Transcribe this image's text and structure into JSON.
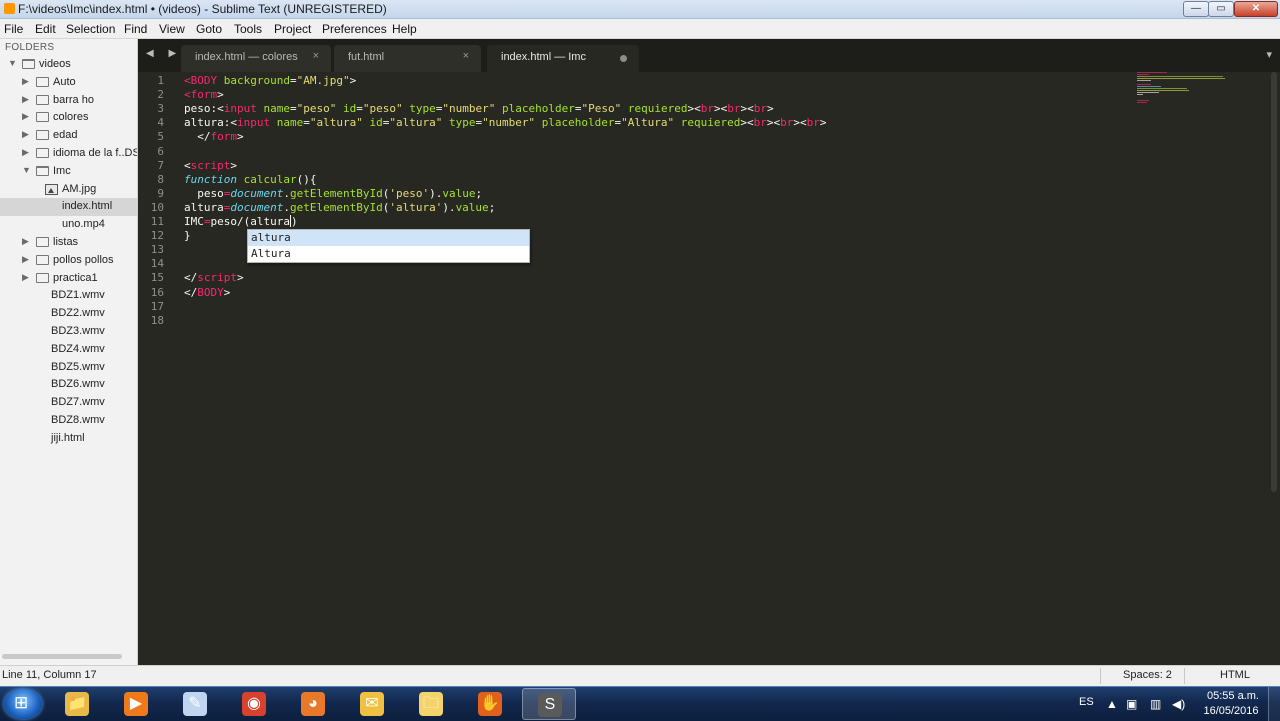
{
  "window": {
    "title": "F:\\videos\\Imc\\index.html • (videos) - Sublime Text (UNREGISTERED)",
    "min_glyph": "—",
    "max_glyph": "▭",
    "close_glyph": "✕"
  },
  "menu": [
    "File",
    "Edit",
    "Selection",
    "Find",
    "View",
    "Goto",
    "Tools",
    "Project",
    "Preferences",
    "Help"
  ],
  "sidebar": {
    "header": "FOLDERS",
    "items": [
      {
        "label": "videos",
        "type": "folder-open",
        "level": 0
      },
      {
        "label": "Auto",
        "type": "folder",
        "level": 1
      },
      {
        "label": "barra ho",
        "type": "folder",
        "level": 1
      },
      {
        "label": "colores",
        "type": "folder",
        "level": 1
      },
      {
        "label": "edad",
        "type": "folder",
        "level": 1
      },
      {
        "label": "idioma de la f..DS",
        "type": "folder",
        "level": 1
      },
      {
        "label": "Imc",
        "type": "folder-open",
        "level": 1
      },
      {
        "label": "AM.jpg",
        "type": "image",
        "level": 2
      },
      {
        "label": "index.html",
        "type": "file",
        "level": 2,
        "selected": true
      },
      {
        "label": "uno.mp4",
        "type": "file",
        "level": 2
      },
      {
        "label": "listas",
        "type": "folder",
        "level": 1
      },
      {
        "label": "pollos pollos",
        "type": "folder",
        "level": 1
      },
      {
        "label": "practica1",
        "type": "folder",
        "level": 1
      },
      {
        "label": "BDZ1.wmv",
        "type": "file",
        "level": 1
      },
      {
        "label": "BDZ2.wmv",
        "type": "file",
        "level": 1
      },
      {
        "label": "BDZ3.wmv",
        "type": "file",
        "level": 1
      },
      {
        "label": "BDZ4.wmv",
        "type": "file",
        "level": 1
      },
      {
        "label": "BDZ5.wmv",
        "type": "file",
        "level": 1
      },
      {
        "label": "BDZ6.wmv",
        "type": "file",
        "level": 1
      },
      {
        "label": "BDZ7.wmv",
        "type": "file",
        "level": 1
      },
      {
        "label": "BDZ8.wmv",
        "type": "file",
        "level": 1
      },
      {
        "label": "jiji.html",
        "type": "file",
        "level": 1
      }
    ]
  },
  "tabs": [
    {
      "label": "index.html — colores",
      "active": false,
      "close": "×"
    },
    {
      "label": "fut.html",
      "active": false,
      "close": "×"
    },
    {
      "label": "index.html — Imc",
      "active": true,
      "dirty": true
    }
  ],
  "tabbar": {
    "nav": "◀ ▶",
    "menu": "▾"
  },
  "editor": {
    "lines": [
      [
        [
          "tag",
          "<"
        ],
        [
          "tag",
          "BODY"
        ],
        [
          "plain",
          " "
        ],
        [
          "attr",
          "background"
        ],
        [
          "plain",
          "="
        ],
        [
          "str",
          "\"AM.jpg\""
        ],
        [
          "plain",
          ">"
        ]
      ],
      [
        [
          "tag",
          "<"
        ],
        [
          "tag",
          "form"
        ],
        [
          "plain",
          ">"
        ]
      ],
      [
        [
          "plain",
          "peso:<"
        ],
        [
          "tag",
          "input"
        ],
        [
          "plain",
          " "
        ],
        [
          "attr",
          "name"
        ],
        [
          "plain",
          "="
        ],
        [
          "str",
          "\"peso\""
        ],
        [
          "plain",
          " "
        ],
        [
          "attr",
          "id"
        ],
        [
          "plain",
          "="
        ],
        [
          "str",
          "\"peso\""
        ],
        [
          "plain",
          " "
        ],
        [
          "attr",
          "type"
        ],
        [
          "plain",
          "="
        ],
        [
          "str",
          "\"number\""
        ],
        [
          "plain",
          " "
        ],
        [
          "attr",
          "placeholder"
        ],
        [
          "plain",
          "="
        ],
        [
          "str",
          "\"Peso\""
        ],
        [
          "plain",
          " "
        ],
        [
          "attr",
          "requiered"
        ],
        [
          "plain",
          ">"
        ],
        [
          "plain",
          "<"
        ],
        [
          "tag",
          "br"
        ],
        [
          "plain",
          "><"
        ],
        [
          "tag",
          "br"
        ],
        [
          "plain",
          "><"
        ],
        [
          "tag",
          "br"
        ],
        [
          "plain",
          ">"
        ]
      ],
      [
        [
          "plain",
          "altura:<"
        ],
        [
          "tag",
          "input"
        ],
        [
          "plain",
          " "
        ],
        [
          "attr",
          "name"
        ],
        [
          "plain",
          "="
        ],
        [
          "str",
          "\"altura\""
        ],
        [
          "plain",
          " "
        ],
        [
          "attr",
          "id"
        ],
        [
          "plain",
          "="
        ],
        [
          "str",
          "\"altura\""
        ],
        [
          "plain",
          " "
        ],
        [
          "attr",
          "type"
        ],
        [
          "plain",
          "="
        ],
        [
          "str",
          "\"number\""
        ],
        [
          "plain",
          " "
        ],
        [
          "attr",
          "placeholder"
        ],
        [
          "plain",
          "="
        ],
        [
          "str",
          "\"Altura\""
        ],
        [
          "plain",
          " "
        ],
        [
          "attr",
          "requiered"
        ],
        [
          "plain",
          ">"
        ],
        [
          "plain",
          "<"
        ],
        [
          "tag",
          "br"
        ],
        [
          "plain",
          "><"
        ],
        [
          "tag",
          "br"
        ],
        [
          "plain",
          "><"
        ],
        [
          "tag",
          "br"
        ],
        [
          "plain",
          ">"
        ]
      ],
      [
        [
          "plain",
          "  </"
        ],
        [
          "tag",
          "form"
        ],
        [
          "plain",
          ">"
        ]
      ],
      [],
      [
        [
          "plain",
          "<"
        ],
        [
          "tag",
          "script"
        ],
        [
          "plain",
          ">"
        ]
      ],
      [
        [
          "kw",
          "function"
        ],
        [
          "plain",
          " "
        ],
        [
          "fn",
          "calcular"
        ],
        [
          "plain",
          "(){"
        ]
      ],
      [
        [
          "plain",
          "  peso"
        ],
        [
          "op",
          "="
        ],
        [
          "dom",
          "document"
        ],
        [
          "plain",
          "."
        ],
        [
          "fn",
          "getElementById"
        ],
        [
          "plain",
          "("
        ],
        [
          "str",
          "'peso'"
        ],
        [
          "plain",
          ")."
        ],
        [
          "fn",
          "value"
        ],
        [
          "plain",
          ";"
        ]
      ],
      [
        [
          "plain",
          "altura"
        ],
        [
          "op",
          "="
        ],
        [
          "dom",
          "document"
        ],
        [
          "plain",
          "."
        ],
        [
          "fn",
          "getElementById"
        ],
        [
          "plain",
          "("
        ],
        [
          "str",
          "'altura'"
        ],
        [
          "plain",
          ")."
        ],
        [
          "fn",
          "value"
        ],
        [
          "plain",
          ";"
        ]
      ],
      [
        [
          "plain",
          "IMC"
        ],
        [
          "op",
          "="
        ],
        [
          "plain",
          "peso/(altura"
        ],
        [
          "caret",
          ""
        ],
        [
          "plain",
          ")"
        ]
      ],
      [
        [
          "plain",
          "}"
        ]
      ],
      [],
      [],
      [
        [
          "plain",
          "</"
        ],
        [
          "tag",
          "script"
        ],
        [
          "plain",
          ">"
        ]
      ],
      [
        [
          "plain",
          "</"
        ],
        [
          "tag",
          "BODY"
        ],
        [
          "plain",
          ">"
        ]
      ],
      [],
      []
    ]
  },
  "autocomplete": {
    "items": [
      "altura",
      "Altura"
    ],
    "selected_index": 0
  },
  "status": {
    "position": "Line 11, Column 17",
    "indent": "Spaces: 2",
    "syntax": "HTML"
  },
  "taskbar": {
    "apps": [
      {
        "name": "file-explorer",
        "glyph": "📁",
        "color": "#e8b84a",
        "active": false
      },
      {
        "name": "media-player",
        "glyph": "▶",
        "color": "#f07a1a",
        "active": false
      },
      {
        "name": "paint",
        "glyph": "✎",
        "color": "#c0d6f0",
        "active": false
      },
      {
        "name": "chrome",
        "glyph": "◉",
        "color": "#d9412f",
        "active": false
      },
      {
        "name": "firefox",
        "glyph": "◕",
        "color": "#e8792a",
        "active": false
      },
      {
        "name": "messenger",
        "glyph": "✉",
        "color": "#f0c040",
        "active": false
      },
      {
        "name": "folder",
        "glyph": "🗀",
        "color": "#f3d36a",
        "active": false
      },
      {
        "name": "vlc-app",
        "glyph": "✋",
        "color": "#e35f1c",
        "active": false
      },
      {
        "name": "sublime-text",
        "glyph": "S",
        "color": "#5a5a5a",
        "active": true
      }
    ],
    "language": "ES",
    "time": "05:55 a.m.",
    "date": "16/05/2016"
  },
  "colors": {
    "editor_bg": "#272822",
    "tag": "#f92672",
    "attr": "#a6e22e",
    "string": "#e6db74",
    "keyword": "#66d9ef",
    "gutter": "#8f908a"
  }
}
